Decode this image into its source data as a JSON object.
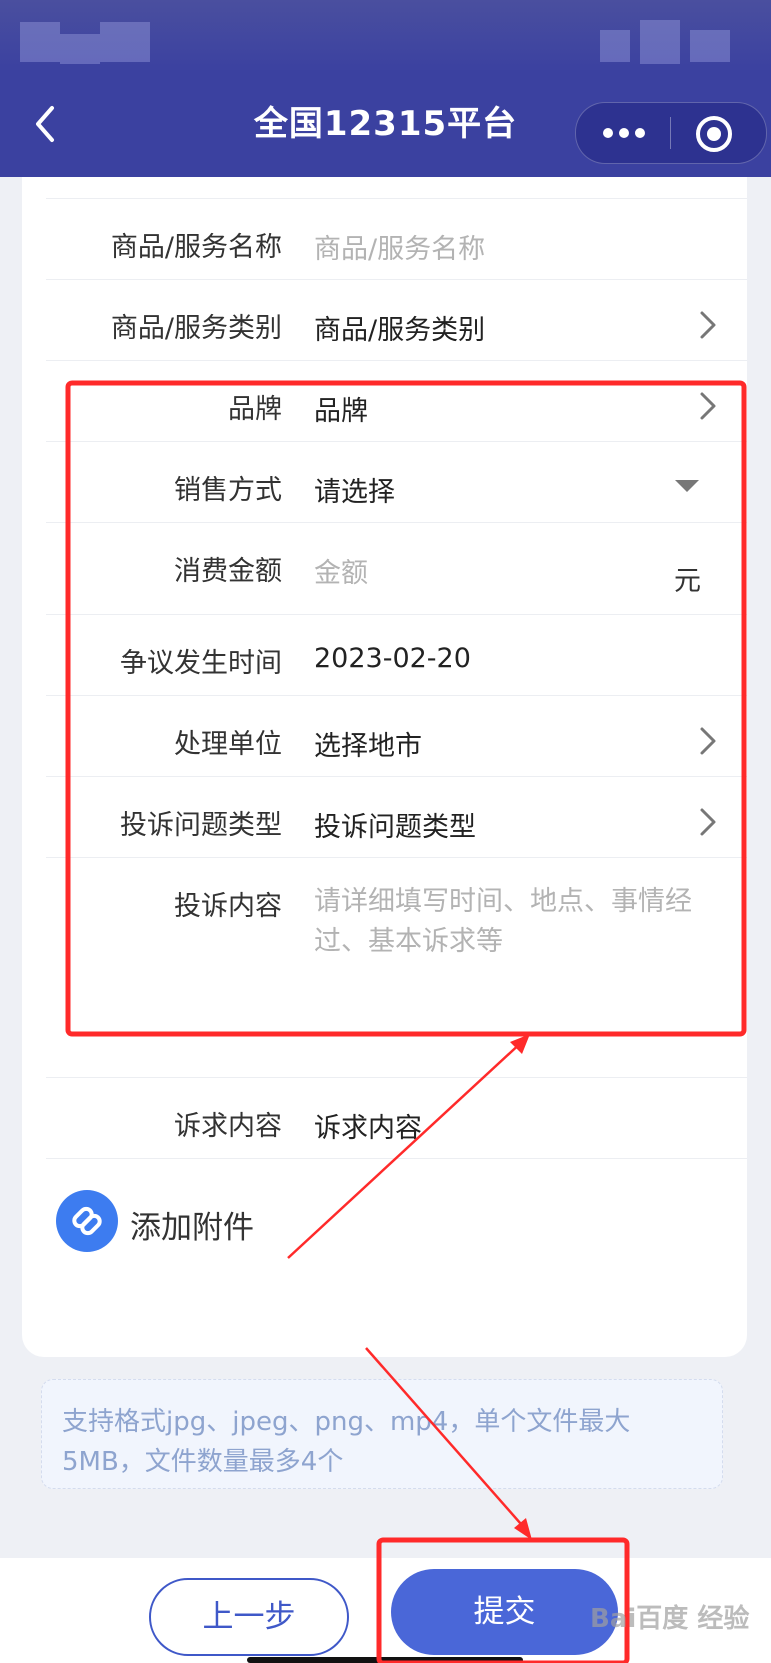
{
  "app": {
    "title": "全国12315平台"
  },
  "form": {
    "rows": [
      {
        "label": "商品/服务名称",
        "value": "商品/服务名称",
        "placeholder": true
      },
      {
        "label": "商品/服务类别",
        "value": "商品/服务类别",
        "placeholder": false
      },
      {
        "label": "品牌",
        "value": "品牌",
        "placeholder": false
      },
      {
        "label": "销售方式",
        "value": "请选择",
        "placeholder": false
      },
      {
        "label": "消费金额",
        "value": "金额",
        "placeholder": true,
        "unit": "元"
      },
      {
        "label": "争议发生时间",
        "value": "2023-02-20",
        "placeholder": false
      },
      {
        "label": "处理单位",
        "value": "选择地市",
        "placeholder": false
      },
      {
        "label": "投诉问题类型",
        "value": "投诉问题类型",
        "placeholder": false
      },
      {
        "label": "投诉内容",
        "value": "请详细填写时间、地点、事情经过、基本诉求等",
        "placeholder": true
      },
      {
        "label": "诉求内容",
        "value": "诉求内容",
        "placeholder": false
      }
    ]
  },
  "attach": {
    "label": "添加附件"
  },
  "notice": {
    "text": "支持格式jpg、jpeg、png、mp4，单个文件最大5MB，文件数量最多4个"
  },
  "actions": {
    "prev_label": "上一步",
    "submit_label": "提交"
  },
  "watermark": {
    "text": "Bai百度 经验"
  },
  "colors": {
    "nav_bg": "#3b41a0",
    "accent": "#4a67d8",
    "highlight": "#ff2a2a"
  },
  "icons": [
    "back-chevron-icon",
    "more-dots-icon",
    "target-icon",
    "chevron-right-icon",
    "dropdown-caret-icon",
    "link-icon"
  ]
}
